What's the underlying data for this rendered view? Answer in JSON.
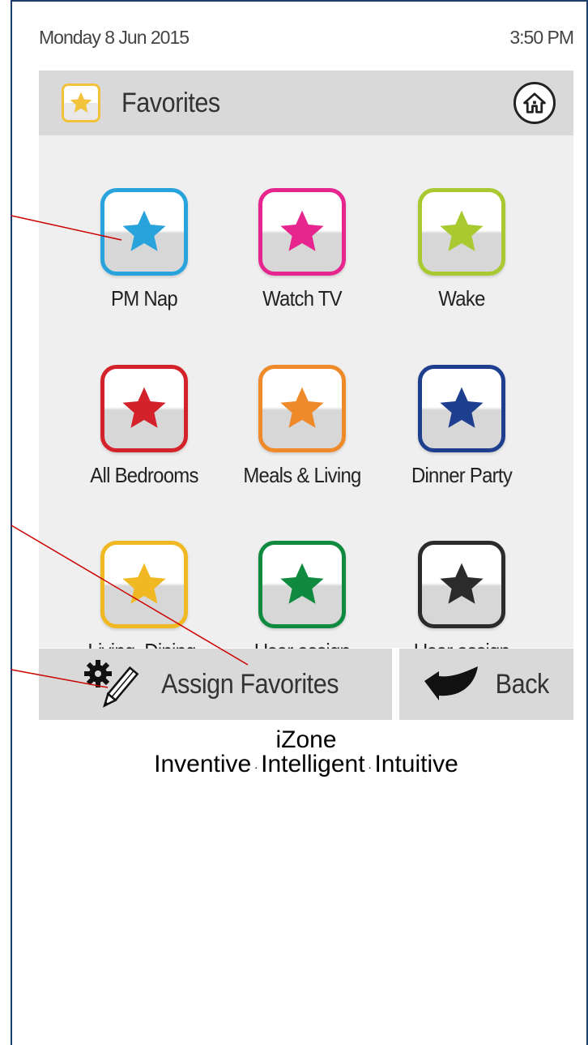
{
  "status_bar": {
    "date": "Monday 8 Jun 2015",
    "time": "3:50 PM"
  },
  "header": {
    "title": "Favorites",
    "icons": {
      "favorites": "star-icon",
      "home": "home-icon"
    }
  },
  "favorites": [
    {
      "label": "PM Nap",
      "color": "#29a3dc"
    },
    {
      "label": "Watch TV",
      "color": "#e6258e"
    },
    {
      "label": "Wake",
      "color": "#a8c92f"
    },
    {
      "label": "All Bedrooms",
      "color": "#d4222a"
    },
    {
      "label": "Meals & Living",
      "color": "#ef8a2a"
    },
    {
      "label": "Dinner Party",
      "color": "#1e3f8f"
    },
    {
      "label": "Living, Dining,\nKitchen",
      "color": "#f0b823"
    },
    {
      "label": "User assign",
      "color": "#0f8a3f"
    },
    {
      "label": "User assign",
      "color": "#2b2b2b"
    }
  ],
  "footer": {
    "assign_label": "Assign Favorites",
    "back_label": "Back",
    "icons": {
      "assign": "gear-pencil-icon",
      "back": "back-arrow-icon"
    }
  },
  "brand": {
    "name": "iZone",
    "tagline_1": "Inventive",
    "tagline_2": "Intelligent",
    "tagline_3": "Intuitive",
    "separator": "."
  },
  "colors": {
    "callout_line": "#cc0000",
    "header_bg": "#d9d9d9",
    "panel_bg": "#efefef",
    "frame": "#1f3f6b"
  }
}
